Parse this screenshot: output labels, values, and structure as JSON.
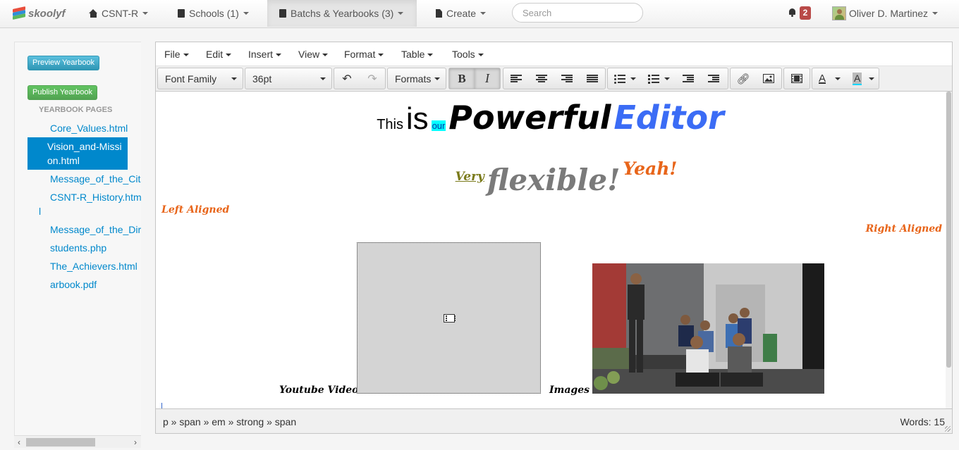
{
  "nav": {
    "brand": "skoolyf",
    "items": [
      {
        "label": "CSNT-R"
      },
      {
        "label": "Schools (1)"
      },
      {
        "label": "Batchs & Yearbooks (3)"
      },
      {
        "label": "Create"
      }
    ],
    "search_placeholder": "Search",
    "notifications_count": "2",
    "user_name": "Oliver D. Martinez"
  },
  "sidebar": {
    "preview_button": "Preview Yearbook",
    "publish_button": "Publish Yearbook",
    "section_header": "YEARBOOK PAGES",
    "pages": [
      {
        "label": "Core_Values.html"
      },
      {
        "label": "Vision_and-Mission.html"
      },
      {
        "label": "Message_of_the_Cit"
      },
      {
        "label": "CSNT-R_History.html"
      },
      {
        "label": "Message_of_the_Dir"
      },
      {
        "label": "students.php"
      },
      {
        "label": "The_Achievers.html"
      },
      {
        "label": "arbook.pdf"
      }
    ]
  },
  "editor": {
    "menu": [
      "File",
      "Edit",
      "Insert",
      "View",
      "Format",
      "Table",
      "Tools"
    ],
    "toolbar": {
      "font_family": "Font Family",
      "font_size": "36pt",
      "formats": "Formats",
      "bold": "B",
      "italic": "I"
    },
    "content": {
      "line1": {
        "this": "This",
        "is": "is",
        "our": "our",
        "powerful": "Powerful",
        "editor": "Editor"
      },
      "line2": {
        "very": "Very",
        "flexible": "flexible!",
        "yeah": "Yeah!"
      },
      "left_aligned": "Left Aligned",
      "right_aligned": "Right Aligned",
      "video_caption": "Youtube Video",
      "images_caption": "Images"
    },
    "status": {
      "path": "p » span » em » strong » span",
      "words": "Words: 15"
    }
  },
  "colors": {
    "accent_blue": "#0088cc",
    "editor_blue": "#3b6cf5",
    "orange": "#e8651a",
    "badge_red": "#b94a48",
    "highlight_cyan": "#00ffff"
  }
}
